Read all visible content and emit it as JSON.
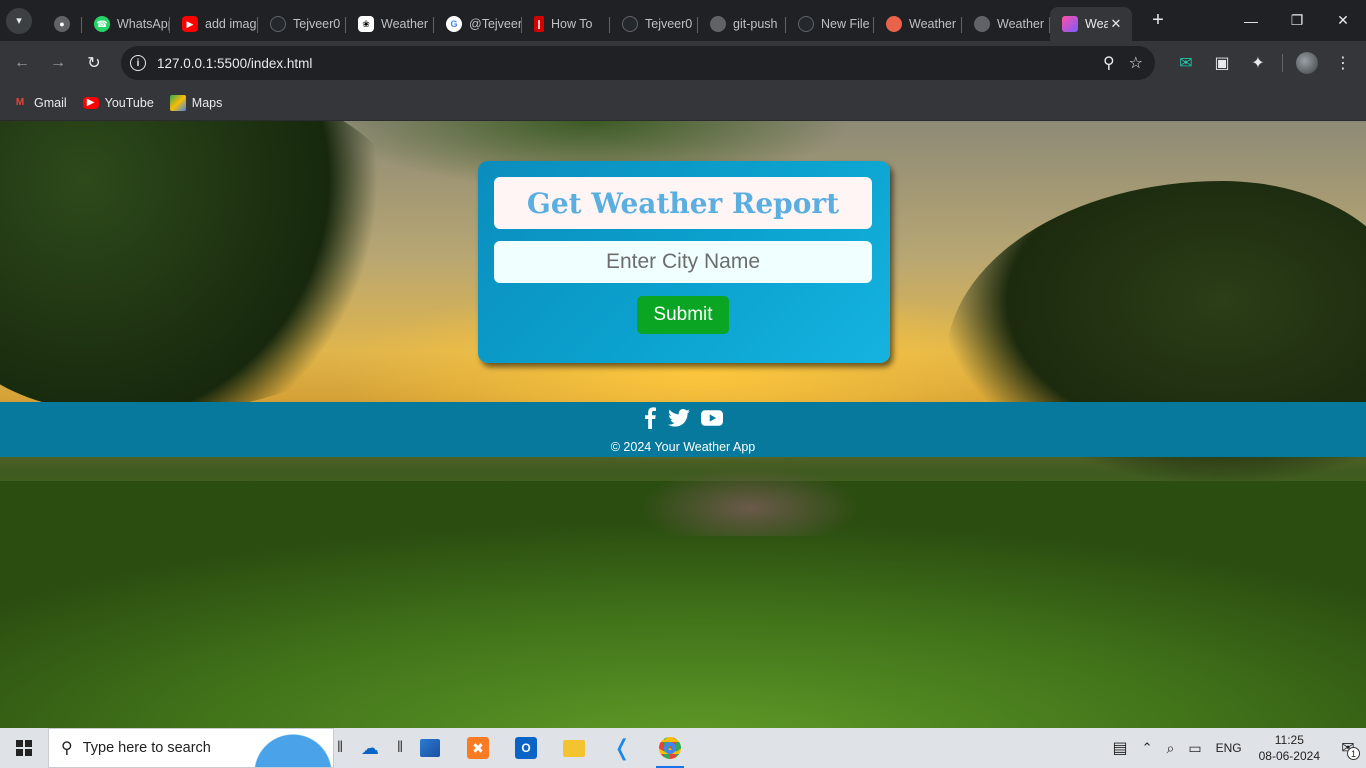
{
  "browser": {
    "tabs": [
      {
        "label": "",
        "favicon": "globe-icon"
      },
      {
        "label": "WhatsApp",
        "favicon": "whatsapp-icon"
      },
      {
        "label": "add image",
        "favicon": "youtube-icon"
      },
      {
        "label": "Tejveer0",
        "favicon": "github-icon"
      },
      {
        "label": "Weather",
        "favicon": "chatgpt-icon"
      },
      {
        "label": "@Tejveer",
        "favicon": "google-icon"
      },
      {
        "label": "How To",
        "favicon": "w3-icon"
      },
      {
        "label": "Tejveer0",
        "favicon": "github-icon"
      },
      {
        "label": "git-push",
        "favicon": "globe-icon"
      },
      {
        "label": "New File",
        "favicon": "github-icon"
      },
      {
        "label": "Weather",
        "favicon": "weather-icon"
      },
      {
        "label": "Weather",
        "favicon": "globe-icon"
      },
      {
        "label": "Weather",
        "favicon": "weather-app-icon",
        "active": true
      }
    ],
    "url": "127.0.0.1:5500/index.html",
    "bookmarks": [
      {
        "label": "Gmail",
        "icon": "gmail-icon"
      },
      {
        "label": "YouTube",
        "icon": "youtube-icon"
      },
      {
        "label": "Maps",
        "icon": "maps-icon"
      }
    ]
  },
  "page": {
    "title": "Get Weather Report",
    "city_placeholder": "Enter City Name",
    "submit_label": "Submit",
    "footer": {
      "social": [
        "facebook-icon",
        "twitter-icon",
        "youtube-icon"
      ],
      "copyright": "© 2024 Your Weather App"
    }
  },
  "taskbar": {
    "search_placeholder": "Type here to search",
    "language": "ENG",
    "time": "11:25",
    "date": "08-06-2024",
    "notification_count": "1"
  },
  "colors": {
    "card_bg": "#0ba2cf",
    "title_text": "#5aaee0",
    "submit_bg": "#0aa523",
    "footer_bg": "#06799d"
  }
}
